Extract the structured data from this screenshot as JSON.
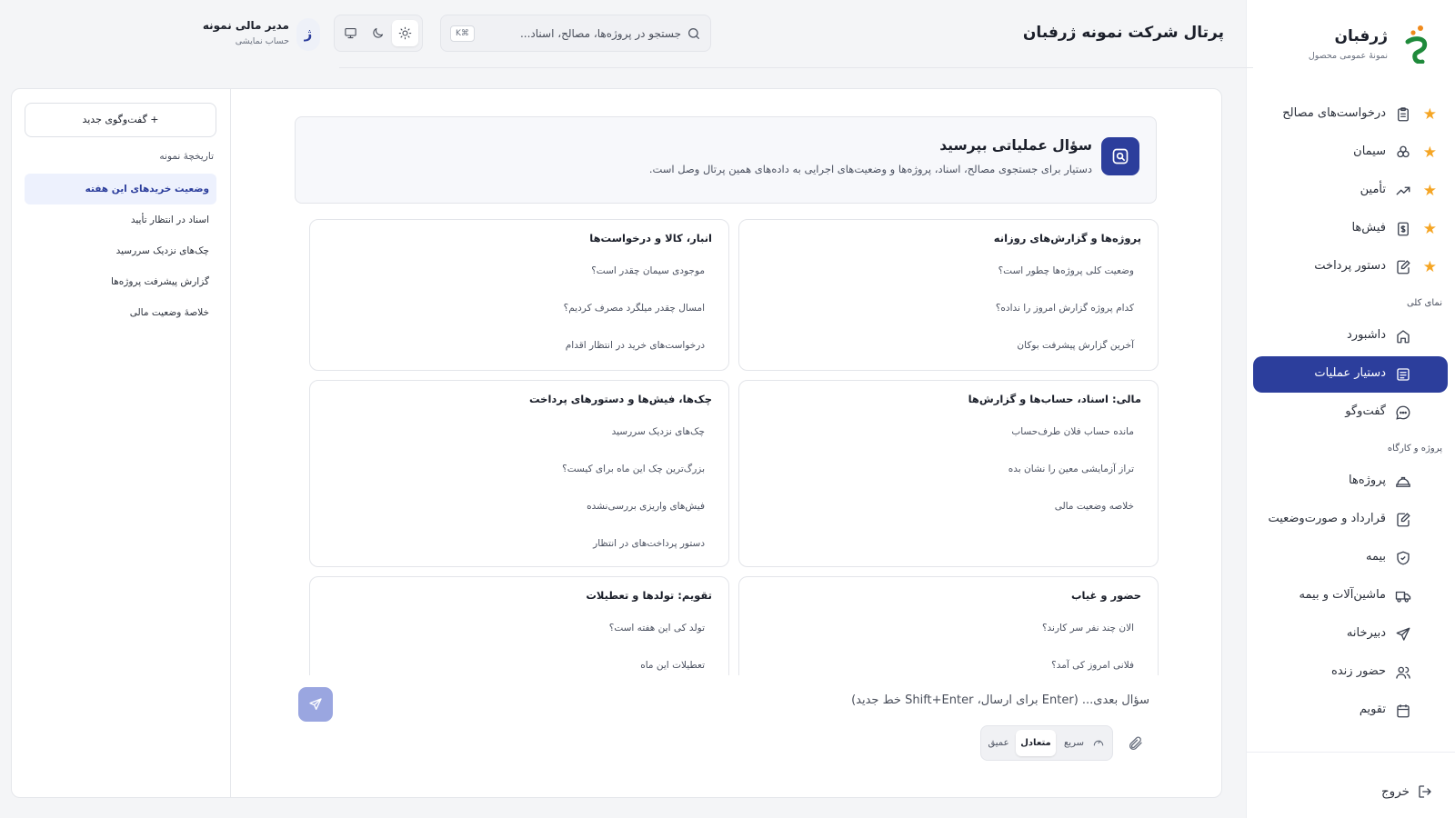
{
  "brand": {
    "name": "ژرفبان",
    "subtitle": "نمونهٔ عمومی محصول",
    "logo_letter": "ژ"
  },
  "header": {
    "title": "پرتال شرکت نمونه ژرفبان",
    "search_placeholder": "جستجو در پروژه‌ها، مصالح، اسناد...",
    "shortcut": "K⌘"
  },
  "theme": {
    "options": [
      "light",
      "dark",
      "system"
    ],
    "selected": "light"
  },
  "user": {
    "name": "مدیر مالی نمونه",
    "role": "حساب نمایشی",
    "avatar": "ژ"
  },
  "sidebar": {
    "favorites": [
      {
        "label": "درخواست‌های مصالح",
        "icon": "clipboard-icon"
      },
      {
        "label": "سیمان",
        "icon": "cement-icon"
      },
      {
        "label": "تأمین",
        "icon": "trend-up-icon"
      },
      {
        "label": "فیش‌ها",
        "icon": "receipt-icon"
      },
      {
        "label": "دستور پرداخت",
        "icon": "edit-doc-icon"
      }
    ],
    "section_overview": "نمای کلی",
    "overview": [
      {
        "label": "داشبورد",
        "icon": "home-icon"
      },
      {
        "label": "دستیار عملیات",
        "icon": "assistant-icon",
        "active": true
      },
      {
        "label": "گفت‌وگو",
        "icon": "chat-icon"
      }
    ],
    "section_projects": "پروژه و کارگاه",
    "projects": [
      {
        "label": "پروژه‌ها",
        "icon": "helmet-icon"
      },
      {
        "label": "قرارداد و صورت‌وضعیت",
        "icon": "contract-icon"
      },
      {
        "label": "بیمه",
        "icon": "shield-icon"
      },
      {
        "label": "ماشین‌آلات و بیمه",
        "icon": "truck-icon"
      },
      {
        "label": "دبیرخانه",
        "icon": "send-icon"
      },
      {
        "label": "حضور زنده",
        "icon": "users-icon"
      },
      {
        "label": "تقویم",
        "icon": "calendar-icon"
      }
    ],
    "logout": "خروج"
  },
  "history": {
    "new_chat": "+ گفت‌وگوی جدید",
    "title": "تاریخچهٔ نمونه",
    "items": [
      "وضعیت خریدهای این هفته",
      "اسناد در انتظار تأیید",
      "چک‌های نزدیک سررسید",
      "گزارش پیشرفت پروژه‌ها",
      "خلاصهٔ وضعیت مالی"
    ]
  },
  "intro": {
    "title": "سؤال عملیاتی بپرسید",
    "description": "دستیار برای جستجوی مصالح، اسناد، پروژه‌ها و وضعیت‌های اجرایی به داده‌های همین پرتال وصل است."
  },
  "cards": [
    {
      "title": "پروژه‌ها و گزارش‌های روزانه",
      "questions": [
        "وضعیت کلی پروژه‌ها چطور است؟",
        "کدام پروژه گزارش امروز را نداده؟",
        "آخرین گزارش پیشرفت بوکان"
      ]
    },
    {
      "title": "انبار، کالا و درخواست‌ها",
      "questions": [
        "موجودی سیمان چقدر است؟",
        "امسال چقدر میلگرد مصرف کردیم؟",
        "درخواست‌های خرید در انتظار اقدام"
      ]
    },
    {
      "title": "مالی: اسناد، حساب‌ها و گزارش‌ها",
      "questions": [
        "مانده حساب فلان طرف‌حساب",
        "تراز آزمایشی معین را نشان بده",
        "خلاصه وضعیت مالی"
      ]
    },
    {
      "title": "چک‌ها، فیش‌ها و دستورهای پرداخت",
      "questions": [
        "چک‌های نزدیک سررسید",
        "بزرگ‌ترین چک این ماه برای کیست؟",
        "فیش‌های واریزی بررسی‌نشده",
        "دستور پرداخت‌های در انتظار"
      ]
    },
    {
      "title": "حضور و غیاب",
      "questions": [
        "الان چند نفر سر کارند؟",
        "فلانی امروز کی آمد؟"
      ]
    },
    {
      "title": "تقویم: تولدها و تعطیلات",
      "questions": [
        "تولد کی این هفته است؟",
        "تعطیلات این ماه"
      ]
    }
  ],
  "composer": {
    "placeholder": "سؤال بعدی... (Enter برای ارسال، Shift+Enter خط جدید)",
    "modes": [
      "سریع",
      "متعادل",
      "عمیق"
    ],
    "selected_mode": "متعادل"
  },
  "colors": {
    "accent": "#2c3e9c",
    "star": "#f5a524",
    "logo_green": "#1f8a3b",
    "logo_orange": "#f08a1c"
  }
}
